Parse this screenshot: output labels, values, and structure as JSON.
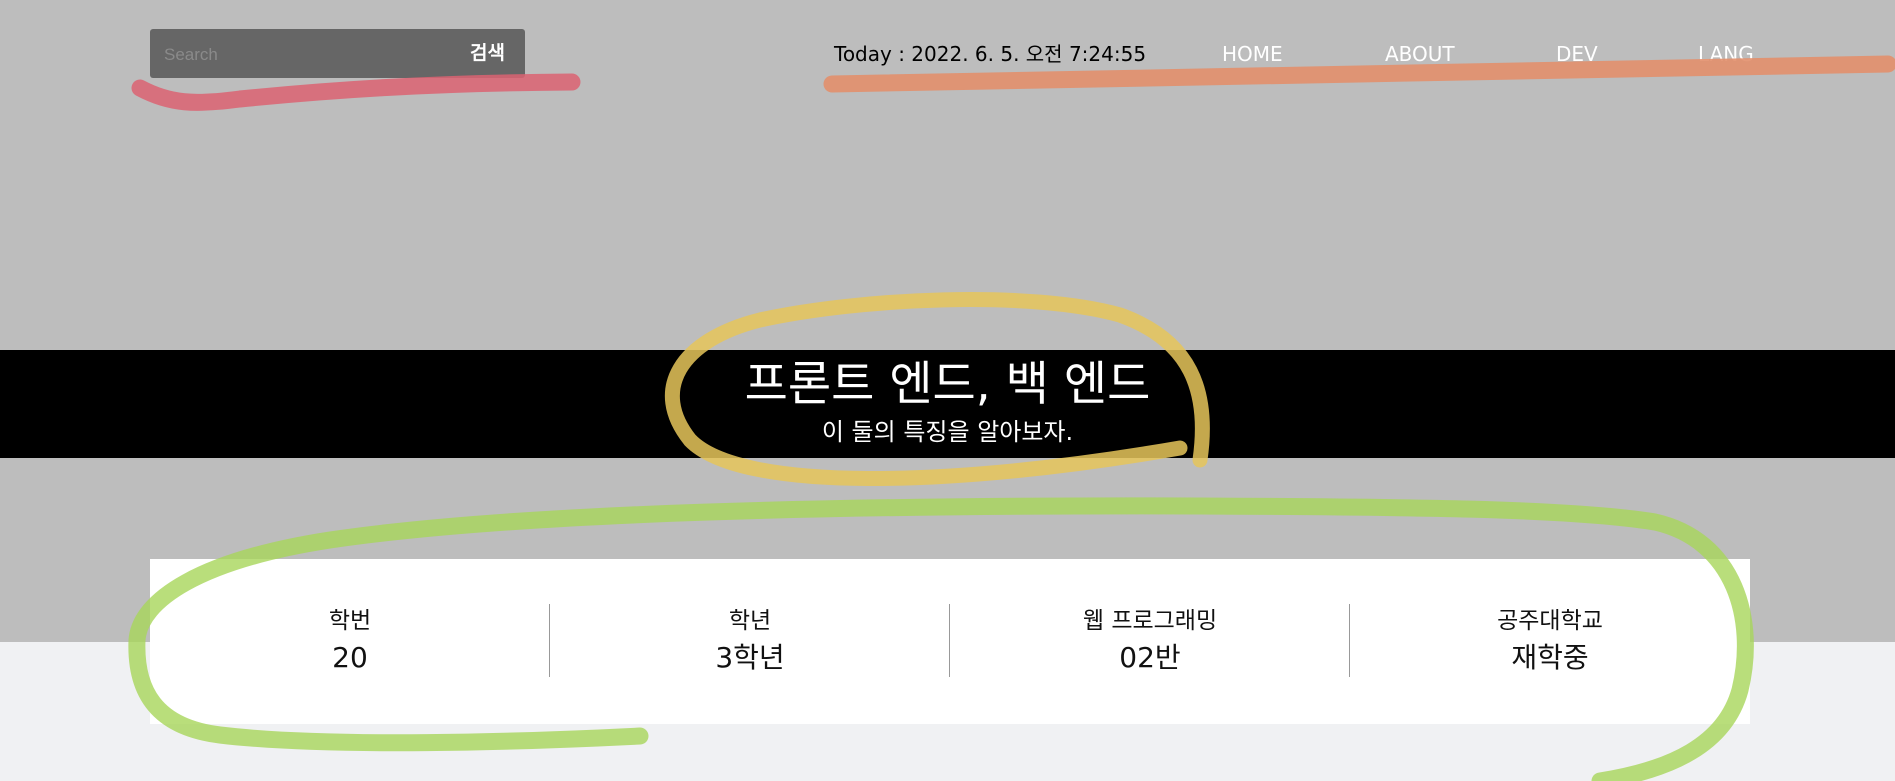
{
  "search": {
    "placeholder": "Search",
    "button_label": "검색"
  },
  "header": {
    "today_text": "Today : 2022. 6. 5. 오전 7:24:55",
    "nav": [
      {
        "label": "HOME"
      },
      {
        "label": "ABOUT"
      },
      {
        "label": "DEV"
      },
      {
        "label": "LANG"
      }
    ]
  },
  "hero": {
    "title": "프론트 엔드, 백 엔드",
    "subtitle": "이 둘의 특징을 알아보자."
  },
  "info": [
    {
      "label": "학번",
      "value": "20"
    },
    {
      "label": "학년",
      "value": "3학년"
    },
    {
      "label": "웹 프로그래밍",
      "value": "02반"
    },
    {
      "label": "공주대학교",
      "value": "재학중"
    }
  ],
  "colors": {
    "background": "#bdbdbd",
    "band": "#000000",
    "search_bg": "#666666",
    "marker_red": "#dc6372",
    "marker_orange": "#e28f6c",
    "marker_yellow": "#e6c55a",
    "marker_green": "#a8d65a"
  }
}
